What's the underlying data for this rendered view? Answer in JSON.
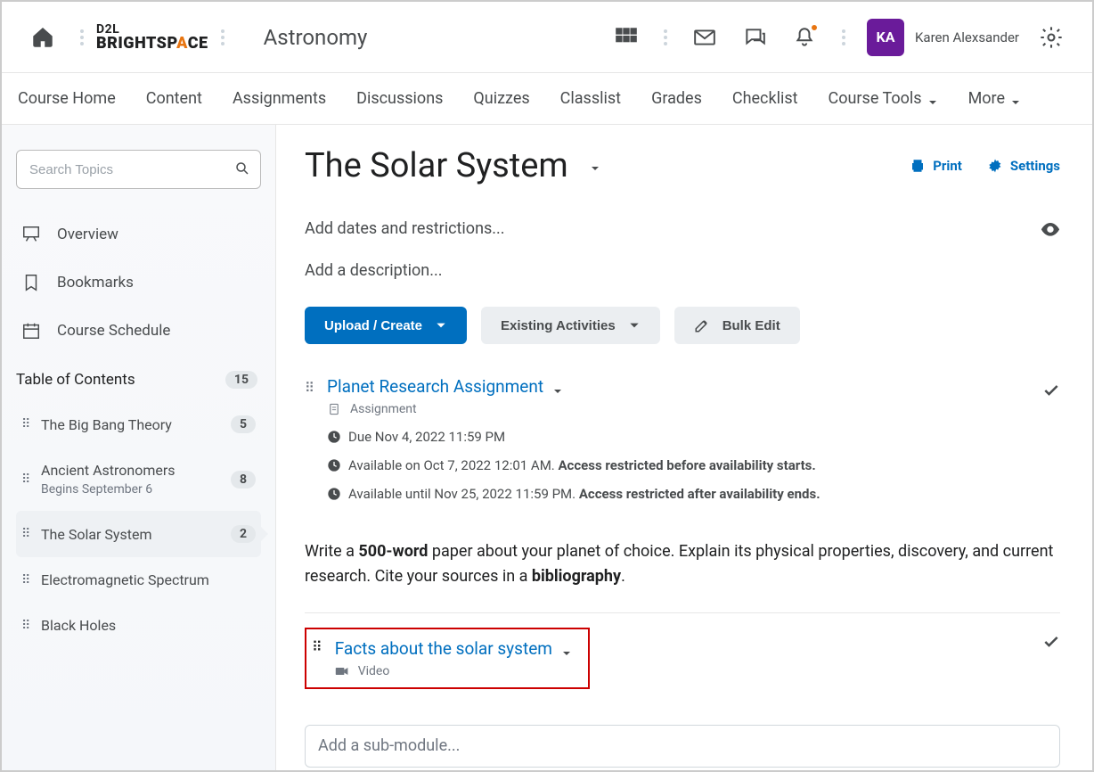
{
  "header": {
    "course_title": "Astronomy",
    "user_initials": "KA",
    "user_name": "Karen Alexsander"
  },
  "nav": [
    "Course Home",
    "Content",
    "Assignments",
    "Discussions",
    "Quizzes",
    "Classlist",
    "Grades",
    "Checklist",
    "Course Tools",
    "More"
  ],
  "sidebar": {
    "search_placeholder": "Search Topics",
    "links": [
      "Overview",
      "Bookmarks",
      "Course Schedule"
    ],
    "toc_label": "Table of Contents",
    "toc_count": "15",
    "items": [
      {
        "label": "The Big Bang Theory",
        "count": "5",
        "sub": ""
      },
      {
        "label": "Ancient Astronomers",
        "count": "8",
        "sub": "Begins September 6"
      },
      {
        "label": "The Solar System",
        "count": "2",
        "sub": ""
      },
      {
        "label": "Electromagnetic Spectrum",
        "count": "",
        "sub": ""
      },
      {
        "label": "Black Holes",
        "count": "",
        "sub": ""
      }
    ]
  },
  "main": {
    "title": "The Solar System",
    "print": "Print",
    "settings": "Settings",
    "dates_hint": "Add dates and restrictions...",
    "desc_hint": "Add a description...",
    "buttons": {
      "upload": "Upload / Create",
      "existing": "Existing Activities",
      "bulk": "Bulk Edit"
    },
    "topic1": {
      "title": "Planet Research Assignment",
      "type": "Assignment",
      "due": "Due Nov 4, 2022 11:59 PM",
      "avail_start_prefix": "Available on Oct 7, 2022 12:01 AM. ",
      "avail_start_bold": "Access restricted before availability starts.",
      "avail_end_prefix": "Available until Nov 25, 2022 11:59 PM. ",
      "avail_end_bold": "Access restricted after availability ends.",
      "desc_p1": "Write a ",
      "desc_b1": "500-word",
      "desc_p2": " paper about your planet of choice. Explain its physical properties, discovery, and current research. Cite your sources in a ",
      "desc_b2": "bibliography",
      "desc_p3": "."
    },
    "topic2": {
      "title": "Facts about the solar system",
      "type": "Video"
    },
    "submodule_hint": "Add a sub-module..."
  }
}
